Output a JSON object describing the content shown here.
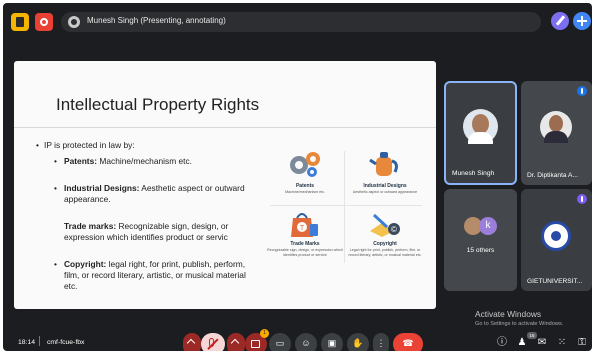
{
  "top_bar": {
    "presenting_label": "Munesh Singh (Presenting, annotating)",
    "icons": [
      "meet-logo-icon",
      "record-icon",
      "presenter-icon",
      "pen-icon",
      "add-icon"
    ]
  },
  "slide": {
    "title": "Intellectual Property Rights",
    "intro": "IP is protected in law by:",
    "bullets": [
      {
        "term": "Patents:",
        "desc": "Machine/mechanism etc."
      },
      {
        "term": "Industrial Designs:",
        "desc": "Aesthetic aspect or outward appearance."
      },
      {
        "term": "Trade marks:",
        "desc": "Recognizable sign, design, or expression which identifies product or servic"
      },
      {
        "term": "Copyright:",
        "desc": "legal right, for print, publish, perform, film, or record literary, artistic, or musical material etc."
      }
    ],
    "icons": [
      {
        "label": "Patents",
        "sub": "Machine/mechanism etc."
      },
      {
        "label": "Industrial Designs",
        "sub": "Aesthetic aspect or outward appearance"
      },
      {
        "label": "Trade Marks",
        "sub": "Recognizable sign, design, or expression which identifies product or service"
      },
      {
        "label": "Copyright",
        "sub": "Legal right for print, publish, perform, film, or record literary, artistic, or musical material etc."
      }
    ]
  },
  "participants": [
    {
      "name": "Munesh Singh",
      "active": true
    },
    {
      "name": "Dr. Diptikanta A..."
    },
    {
      "name": "15 others",
      "initial": "k"
    },
    {
      "name": "GIETUNIVERSIT..."
    }
  ],
  "watermark": {
    "title": "Activate Windows",
    "subtitle": "Go to Settings to activate Windows."
  },
  "bottom_bar": {
    "time": "18:14",
    "meeting_code": "cmf-fcue-fbx",
    "camera_badge": "1",
    "people_count": "16",
    "accent_colors": {
      "hangup": "#ea4335",
      "mic_off": "#f6d7d5",
      "cam_off": "#9b2a26"
    }
  }
}
